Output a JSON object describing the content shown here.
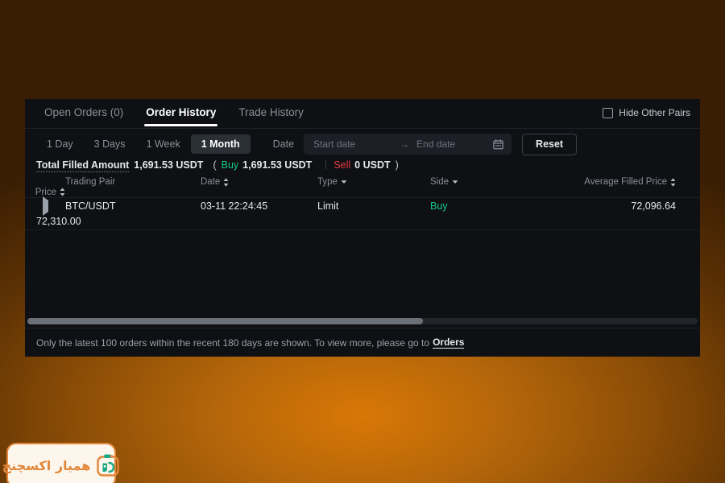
{
  "panel": {
    "tabs": [
      {
        "label": "Open Orders (0)",
        "name": "open-orders",
        "active": false
      },
      {
        "label": "Order History",
        "name": "order-history",
        "active": true
      },
      {
        "label": "Trade History",
        "name": "trade-history",
        "active": false
      }
    ],
    "hide_other_pairs": {
      "label": "Hide Other Pairs",
      "checked": false
    },
    "filters": {
      "periods": [
        {
          "label": "1 Day",
          "active": false
        },
        {
          "label": "3 Days",
          "active": false
        },
        {
          "label": "1 Week",
          "active": false
        },
        {
          "label": "1 Month",
          "active": true
        }
      ],
      "date_label": "Date",
      "start_date_placeholder": "Start date",
      "start_date_value": "",
      "range_arrow": "→",
      "end_date_placeholder": "End date",
      "end_date_value": "",
      "calendar_icon": "calendar-icon",
      "reset_label": "Reset"
    },
    "totals": {
      "label": "Total Filled Amount",
      "value": "1,691.53 USDT",
      "open_paren": "(",
      "buy_label": "Buy",
      "buy_value": "1,691.53 USDT",
      "sell_label": "Sell",
      "sell_value": "0 USDT",
      "close_paren": ")"
    },
    "table": {
      "headers": [
        {
          "label": "Trading Pair",
          "align": "left",
          "control": "none"
        },
        {
          "label": "Date",
          "align": "left",
          "control": "sort"
        },
        {
          "label": "Type",
          "align": "left",
          "control": "filter"
        },
        {
          "label": "Side",
          "align": "left",
          "control": "filter"
        },
        {
          "label": "Average Filled Price",
          "align": "right",
          "control": "sort"
        },
        {
          "label": "Price",
          "align": "right",
          "control": "sort"
        }
      ],
      "rows": [
        {
          "expander": "expand-triangle-icon",
          "pair": "BTC/USDT",
          "date": "03-11 22:24:45",
          "type": "Limit",
          "side": "Buy",
          "side_kind": "buy",
          "avg_filled_price": "72,096.64",
          "price": "72,310.00"
        }
      ]
    },
    "scrollbar": {
      "thumb_percent": 59
    },
    "footer": {
      "text": "Only the latest 100 orders within the recent 180 days are shown. To view more, please go to",
      "link_label": "Orders"
    }
  },
  "watermark": {
    "text": "همیار اکسچنج",
    "logo_icon": "hamyar-exchange-logo"
  },
  "colors": {
    "buy_green": "#16c784",
    "sell_red": "#ea3943",
    "panel_bg": "#0e1013",
    "accent_orange": "#d97706"
  }
}
